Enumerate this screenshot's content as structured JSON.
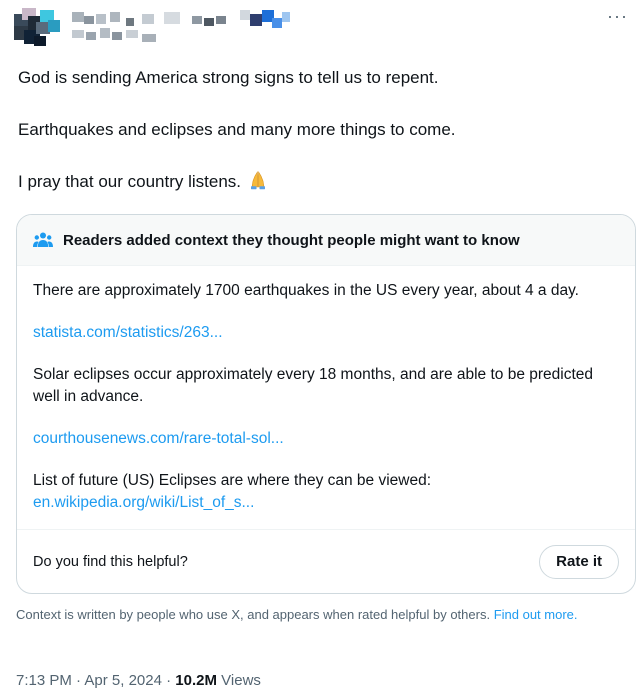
{
  "header": {
    "more_label": "···"
  },
  "tweet": {
    "lines": [
      "God is sending America strong signs to tell us to repent.",
      "Earthquakes and eclipses and many more things to come.",
      "I pray that our country listens."
    ],
    "emoji": "folded-hands-emoji"
  },
  "community_note": {
    "title": "Readers added context they thought people might want to know",
    "paragraphs": [
      "There are approximately 1700 earthquakes in the US every year, about 4 a day.",
      "Solar eclipses occur approximately every 18 months, and are able to be predicted well in advance.",
      "List of future (US) Eclipses are where they can be viewed:"
    ],
    "links": [
      "statista.com/statistics/263...",
      "courthousenews.com/rare-total-sol...",
      "en.wikipedia.org/wiki/List_of_s..."
    ],
    "helpful_prompt": "Do you find this helpful?",
    "rate_label": "Rate it"
  },
  "context_footer": {
    "text": "Context is written by people who use X, and appears when rated helpful by others.",
    "link": "Find out more."
  },
  "meta": {
    "time": "7:13 PM",
    "date": "Apr 5, 2024",
    "views_count": "10.2M",
    "views_label": "Views"
  },
  "colors": {
    "link": "#1d9bf0",
    "text": "#0f1419",
    "muted": "#536471",
    "border": "#cfd9de"
  }
}
